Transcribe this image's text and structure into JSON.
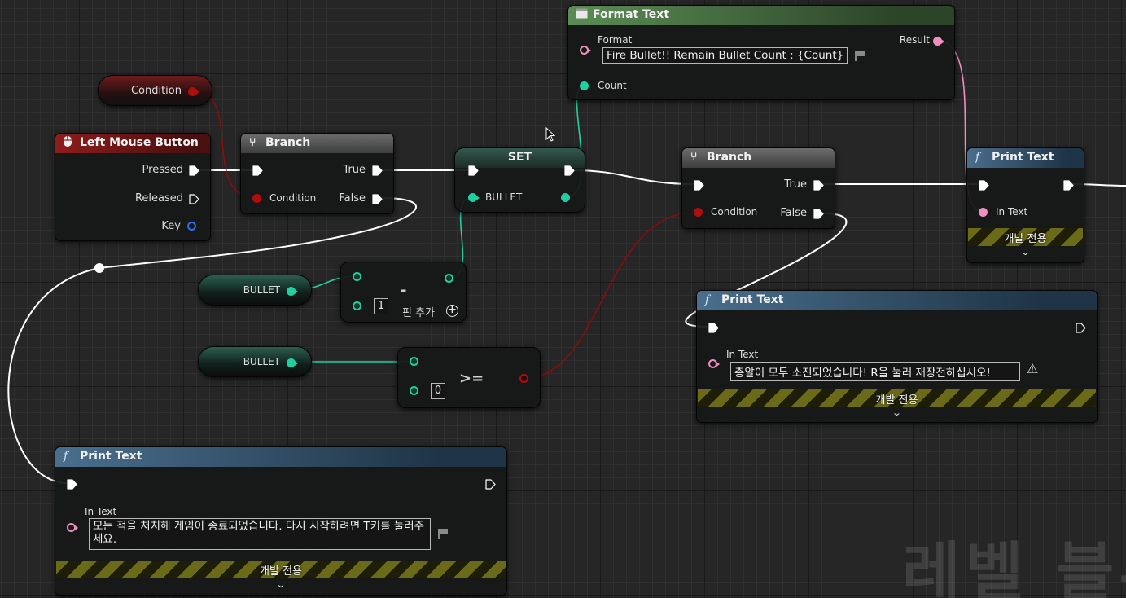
{
  "colors": {
    "exec_wire": "#ffffff",
    "integer_pin": "#1fd0a0",
    "bool_pin": "#b00d0d",
    "text_pin": "#ee8fbf",
    "key_pin": "#2f6df0",
    "event_header": "#8e1d1d",
    "function_header": "#4a6e8d",
    "format_header": "#5b8c55"
  },
  "condition_getter": {
    "label": "Condition"
  },
  "left_mouse_button": {
    "title": "Left Mouse Button",
    "icon": "mouse-icon",
    "pressed_label": "Pressed",
    "released_label": "Released",
    "key_label": "Key"
  },
  "branch1": {
    "title": "Branch",
    "true_label": "True",
    "false_label": "False",
    "condition_label": "Condition"
  },
  "format_text": {
    "title": "Format Text",
    "format_label": "Format",
    "format_value": "Fire Bullet!! Remain Bullet Count : {Count}",
    "count_label": "Count",
    "result_label": "Result"
  },
  "set_node": {
    "title": "SET",
    "var_label": "BULLET"
  },
  "branch2": {
    "title": "Branch",
    "true_label": "True",
    "false_label": "False",
    "condition_label": "Condition"
  },
  "print_top": {
    "title": "Print Text",
    "in_text_label": "In Text",
    "dev_label": "개발 전용",
    "expand_icon": "chevron-down-icon"
  },
  "bullet_getter1": {
    "label": "BULLET"
  },
  "bullet_getter2": {
    "label": "BULLET"
  },
  "subtract_node": {
    "value": "1",
    "operator": "-",
    "add_pin_label": "핀 추가",
    "add_pin_icon": "plus-circle-icon"
  },
  "compare_node": {
    "value": "0",
    "operator": ">="
  },
  "print_mid": {
    "title": "Print Text",
    "in_text_label": "In Text",
    "in_text_value": "총알이 모두 소진되었습니다! R을 눌러 재장전하십시오!",
    "dev_label": "개발 전용"
  },
  "print_bottom": {
    "title": "Print Text",
    "in_text_label": "In Text",
    "in_text_value": "모든 적을 처치해 게임이 종료되었습니다. 다시 시작하려면 T키를 눌러주세요.",
    "dev_label": "개발 전용"
  },
  "watermark": {
    "text": "레벨 블루"
  }
}
